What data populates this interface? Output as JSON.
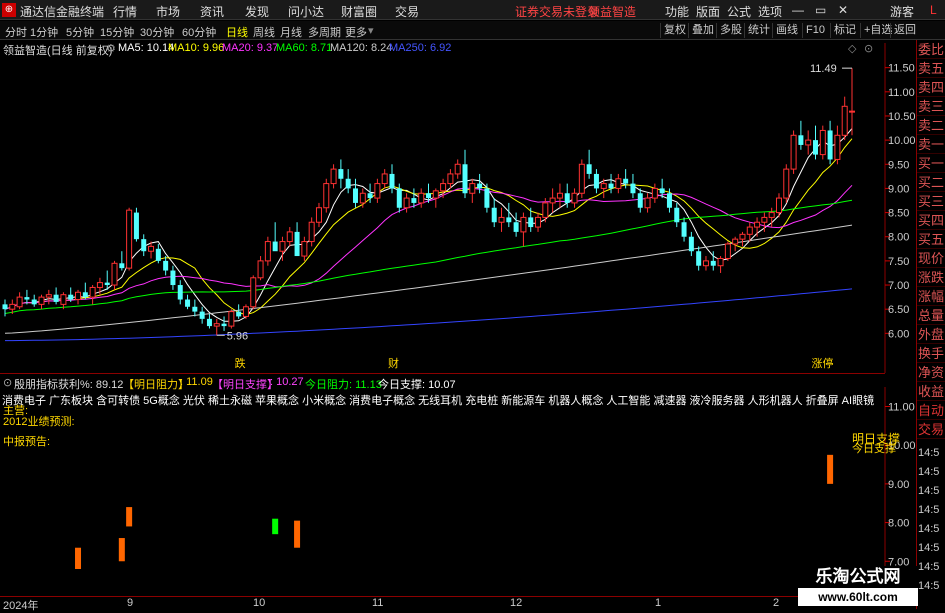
{
  "app": {
    "title": "通达信金融终端"
  },
  "menu": {
    "items": [
      "行情",
      "市场",
      "资讯",
      "发现",
      "问小达",
      "财富圈",
      "交易"
    ],
    "status": "证券交易未登录",
    "stock_tag": "领益智造",
    "right_items": [
      "功能",
      "版面",
      "公式",
      "选项"
    ],
    "guest": "游客",
    "icons": {
      "minimize": "—",
      "restore": "▭",
      "close": "✕"
    }
  },
  "toolbar": {
    "periods": [
      "分时",
      "1分钟",
      "5分钟",
      "15分钟",
      "30分钟",
      "60分钟",
      "日线",
      "周线",
      "月线",
      "多周期",
      "更多"
    ],
    "active": "日线",
    "right": [
      "复权",
      "叠加",
      "多股",
      "统计",
      "画线",
      "F10",
      "标记",
      "+自选",
      "返回"
    ]
  },
  "header": {
    "name": "领益智造(日线 前复权)",
    "ma": [
      {
        "label": "MA5: 10.14",
        "color": "#ffffff"
      },
      {
        "label": "MA10: 9.96",
        "color": "#ffff00"
      },
      {
        "label": "MA20: 9.37",
        "color": "#ff33ff"
      },
      {
        "label": "MA60: 8.71",
        "color": "#00ff00"
      },
      {
        "label": "MA120: 8.24",
        "color": "#cccccc"
      },
      {
        "label": "MA250: 6.92",
        "color": "#4455ff"
      }
    ]
  },
  "price_axis": {
    "labels": [
      "11.50",
      "11.00",
      "10.50",
      "10.00",
      "9.50",
      "9.00",
      "8.50",
      "8.00",
      "7.50",
      "7.00",
      "6.50",
      "6.00"
    ],
    "high": "11.49",
    "low": "5.96"
  },
  "chart_data": {
    "type": "candlestick",
    "ylim": [
      5.8,
      11.7
    ],
    "candles": [
      [
        6.6,
        6.7,
        6.35,
        6.5
      ],
      [
        6.5,
        6.7,
        6.4,
        6.6
      ],
      [
        6.55,
        6.85,
        6.5,
        6.75
      ],
      [
        6.75,
        6.9,
        6.6,
        6.7
      ],
      [
        6.7,
        6.8,
        6.55,
        6.6
      ],
      [
        6.6,
        6.8,
        6.5,
        6.75
      ],
      [
        6.75,
        6.9,
        6.6,
        6.8
      ],
      [
        6.8,
        6.95,
        6.6,
        6.65
      ],
      [
        6.6,
        6.85,
        6.5,
        6.8
      ],
      [
        6.8,
        6.95,
        6.65,
        6.7
      ],
      [
        6.7,
        6.9,
        6.6,
        6.85
      ],
      [
        6.85,
        7.05,
        6.7,
        6.75
      ],
      [
        6.75,
        7.0,
        6.6,
        6.95
      ],
      [
        6.95,
        7.15,
        6.8,
        7.05
      ],
      [
        7.05,
        7.3,
        6.9,
        7.0
      ],
      [
        7.0,
        7.5,
        6.9,
        7.45
      ],
      [
        7.45,
        7.7,
        7.3,
        7.35
      ],
      [
        7.35,
        8.6,
        7.3,
        8.55
      ],
      [
        8.5,
        8.6,
        7.9,
        7.95
      ],
      [
        7.95,
        8.05,
        7.6,
        7.7
      ],
      [
        7.7,
        7.9,
        7.55,
        7.8
      ],
      [
        7.75,
        7.85,
        7.45,
        7.5
      ],
      [
        7.5,
        7.6,
        7.2,
        7.3
      ],
      [
        7.3,
        7.4,
        6.9,
        7.0
      ],
      [
        7.0,
        7.1,
        6.6,
        6.7
      ],
      [
        6.7,
        6.8,
        6.5,
        6.55
      ],
      [
        6.55,
        6.7,
        6.35,
        6.45
      ],
      [
        6.45,
        6.55,
        6.2,
        6.3
      ],
      [
        6.3,
        6.4,
        6.1,
        6.15
      ],
      [
        6.15,
        6.3,
        5.96,
        6.2
      ],
      [
        6.2,
        6.35,
        6.05,
        6.15
      ],
      [
        6.15,
        6.5,
        6.1,
        6.45
      ],
      [
        6.45,
        6.6,
        6.3,
        6.35
      ],
      [
        6.35,
        6.6,
        6.3,
        6.55
      ],
      [
        6.55,
        7.2,
        6.5,
        7.15
      ],
      [
        7.15,
        7.6,
        7.1,
        7.5
      ],
      [
        7.5,
        8.0,
        7.4,
        7.9
      ],
      [
        7.9,
        8.3,
        7.8,
        7.7
      ],
      [
        7.7,
        8.0,
        7.5,
        7.9
      ],
      [
        7.9,
        8.2,
        7.8,
        8.1
      ],
      [
        8.1,
        8.3,
        7.9,
        7.6
      ],
      [
        7.6,
        8.0,
        7.5,
        7.9
      ],
      [
        7.9,
        8.4,
        7.8,
        8.3
      ],
      [
        8.3,
        8.7,
        8.2,
        8.6
      ],
      [
        8.6,
        9.2,
        8.5,
        9.1
      ],
      [
        9.1,
        9.5,
        9.0,
        9.4
      ],
      [
        9.4,
        9.6,
        9.0,
        9.2
      ],
      [
        9.2,
        9.4,
        8.9,
        9.0
      ],
      [
        9.0,
        9.2,
        8.6,
        8.7
      ],
      [
        8.7,
        9.0,
        8.6,
        8.9
      ],
      [
        8.9,
        9.1,
        8.7,
        8.8
      ],
      [
        8.8,
        9.2,
        8.7,
        9.1
      ],
      [
        9.1,
        9.4,
        9.0,
        9.3
      ],
      [
        9.3,
        9.5,
        8.9,
        9.0
      ],
      [
        9.0,
        9.1,
        8.5,
        8.6
      ],
      [
        8.6,
        8.9,
        8.5,
        8.8
      ],
      [
        8.8,
        9.0,
        8.6,
        8.7
      ],
      [
        8.7,
        9.0,
        8.6,
        8.9
      ],
      [
        8.9,
        9.1,
        8.7,
        8.8
      ],
      [
        8.8,
        9.0,
        8.6,
        8.95
      ],
      [
        8.95,
        9.2,
        8.8,
        9.1
      ],
      [
        9.1,
        9.4,
        9.0,
        9.3
      ],
      [
        9.3,
        9.6,
        9.2,
        9.5
      ],
      [
        9.5,
        9.8,
        8.8,
        8.9
      ],
      [
        8.9,
        9.2,
        8.7,
        9.1
      ],
      [
        9.1,
        9.3,
        8.9,
        9.0
      ],
      [
        9.0,
        9.1,
        8.5,
        8.6
      ],
      [
        8.6,
        8.8,
        8.2,
        8.3
      ],
      [
        8.3,
        8.6,
        8.1,
        8.4
      ],
      [
        8.4,
        8.7,
        8.2,
        8.3
      ],
      [
        8.3,
        8.5,
        8.0,
        8.1
      ],
      [
        8.1,
        8.5,
        7.8,
        8.4
      ],
      [
        8.4,
        8.6,
        8.1,
        8.2
      ],
      [
        8.2,
        8.5,
        8.1,
        8.4
      ],
      [
        8.4,
        8.8,
        8.3,
        8.7
      ],
      [
        8.7,
        9.0,
        8.5,
        8.8
      ],
      [
        8.8,
        9.1,
        8.6,
        8.9
      ],
      [
        8.9,
        9.1,
        8.6,
        8.7
      ],
      [
        8.7,
        9.0,
        8.6,
        8.9
      ],
      [
        8.9,
        9.6,
        8.8,
        9.5
      ],
      [
        9.5,
        9.8,
        9.2,
        9.3
      ],
      [
        9.3,
        9.4,
        8.9,
        9.0
      ],
      [
        9.0,
        9.2,
        8.8,
        9.1
      ],
      [
        9.1,
        9.3,
        8.9,
        9.0
      ],
      [
        9.0,
        9.3,
        8.9,
        9.2
      ],
      [
        9.2,
        9.4,
        9.0,
        9.1
      ],
      [
        9.1,
        9.3,
        8.8,
        8.9
      ],
      [
        8.9,
        9.0,
        8.5,
        8.6
      ],
      [
        8.6,
        8.9,
        8.5,
        8.8
      ],
      [
        8.8,
        9.1,
        8.7,
        9.0
      ],
      [
        9.0,
        9.2,
        8.8,
        8.9
      ],
      [
        8.9,
        9.0,
        8.5,
        8.6
      ],
      [
        8.6,
        8.7,
        8.2,
        8.3
      ],
      [
        8.3,
        8.4,
        7.9,
        8.0
      ],
      [
        8.0,
        8.1,
        7.6,
        7.7
      ],
      [
        7.7,
        7.8,
        7.3,
        7.4
      ],
      [
        7.4,
        7.6,
        7.3,
        7.5
      ],
      [
        7.5,
        7.7,
        7.3,
        7.4
      ],
      [
        7.4,
        7.6,
        7.25,
        7.55
      ],
      [
        7.55,
        7.9,
        7.5,
        7.85
      ],
      [
        7.85,
        8.0,
        7.7,
        7.95
      ],
      [
        7.95,
        8.1,
        7.8,
        8.05
      ],
      [
        8.05,
        8.3,
        7.9,
        8.2
      ],
      [
        8.2,
        8.4,
        8.0,
        8.3
      ],
      [
        8.3,
        8.5,
        8.1,
        8.4
      ],
      [
        8.4,
        8.6,
        8.2,
        8.5
      ],
      [
        8.5,
        8.9,
        8.4,
        8.8
      ],
      [
        8.8,
        9.5,
        8.7,
        9.4
      ],
      [
        9.4,
        10.2,
        9.3,
        10.1
      ],
      [
        10.1,
        10.4,
        9.8,
        9.9
      ],
      [
        9.9,
        10.2,
        9.7,
        10.0
      ],
      [
        10.0,
        10.3,
        9.6,
        9.7
      ],
      [
        9.7,
        10.3,
        9.6,
        10.2
      ],
      [
        10.2,
        10.4,
        9.5,
        9.6
      ],
      [
        9.6,
        10.3,
        9.5,
        10.1
      ],
      [
        10.1,
        10.9,
        10.0,
        10.7
      ],
      [
        10.6,
        11.49,
        10.1,
        10.6
      ]
    ],
    "ma_legend": [
      "MA5",
      "MA10",
      "MA20",
      "MA60",
      "MA120",
      "MA250"
    ],
    "markers": [
      {
        "idx": 32,
        "text": "跌"
      },
      {
        "idx": 53,
        "text": "财"
      },
      {
        "idx": 111,
        "text": "涨停"
      }
    ],
    "sub_bars": [
      {
        "idx": 10,
        "lo": 6.8,
        "hi": 7.35,
        "color": "#ff6600"
      },
      {
        "idx": 16,
        "lo": 7.0,
        "hi": 7.6,
        "color": "#ff6600"
      },
      {
        "idx": 17,
        "lo": 7.9,
        "hi": 8.4,
        "color": "#ff6600"
      },
      {
        "idx": 37,
        "lo": 7.7,
        "hi": 8.1,
        "color": "#00ff00"
      },
      {
        "idx": 40,
        "lo": 7.35,
        "hi": 8.05,
        "color": "#ff6600"
      },
      {
        "idx": 113,
        "lo": 9.0,
        "hi": 9.75,
        "color": "#ff6600"
      }
    ],
    "sub_ylim": [
      6.8,
      11.4
    ]
  },
  "sub_axis": {
    "labels": [
      "11.00",
      "10.00",
      "9.00",
      "8.00",
      "7.00"
    ],
    "legend": [
      "明日支撑",
      "今日支撑"
    ]
  },
  "subinfo": {
    "name": "殷朋指标",
    "profit": "获利%: 89.12",
    "resist_label": "【明日阻力】",
    "resist": ": 11.09",
    "support_label": "【明日支撑】",
    "support": ": 10.27",
    "today_resist": "今日阻力: 11.13",
    "today_support": "今日支撑: 10.07"
  },
  "concepts": "消费电子 广东板块 含可转债 5G概念 光伏 稀土永磁 苹果概念 小米概念 消费电子概念 无线耳机 充电桩 新能源车 机器人概念 人工智能 减速器 液冷服务器 人形机器人 折叠屏 AI眼镜",
  "labels": {
    "main_biz": "主营:",
    "forecast": "2012业绩预测:",
    "midreport": "中报预告:"
  },
  "xaxis": [
    "2024年",
    "9",
    "10",
    "11",
    "12",
    "1",
    "2"
  ],
  "side_tabs": [
    "委比",
    "卖五",
    "卖四",
    "卖三",
    "卖二",
    "卖一",
    "买一",
    "买二",
    "买三",
    "买四",
    "买五",
    "现价",
    "涨跌",
    "涨幅",
    "总量",
    "外盘",
    "换手",
    "净资",
    "收益"
  ],
  "side_tabs2": [
    "自动",
    "交易"
  ],
  "time_labels": [
    "14:5",
    "14:5",
    "14:5",
    "14:5",
    "14:5",
    "14:5",
    "14:5",
    "14:5"
  ],
  "watermark": {
    "cn": "乐淘公式网",
    "url": "www.60lt.com"
  }
}
